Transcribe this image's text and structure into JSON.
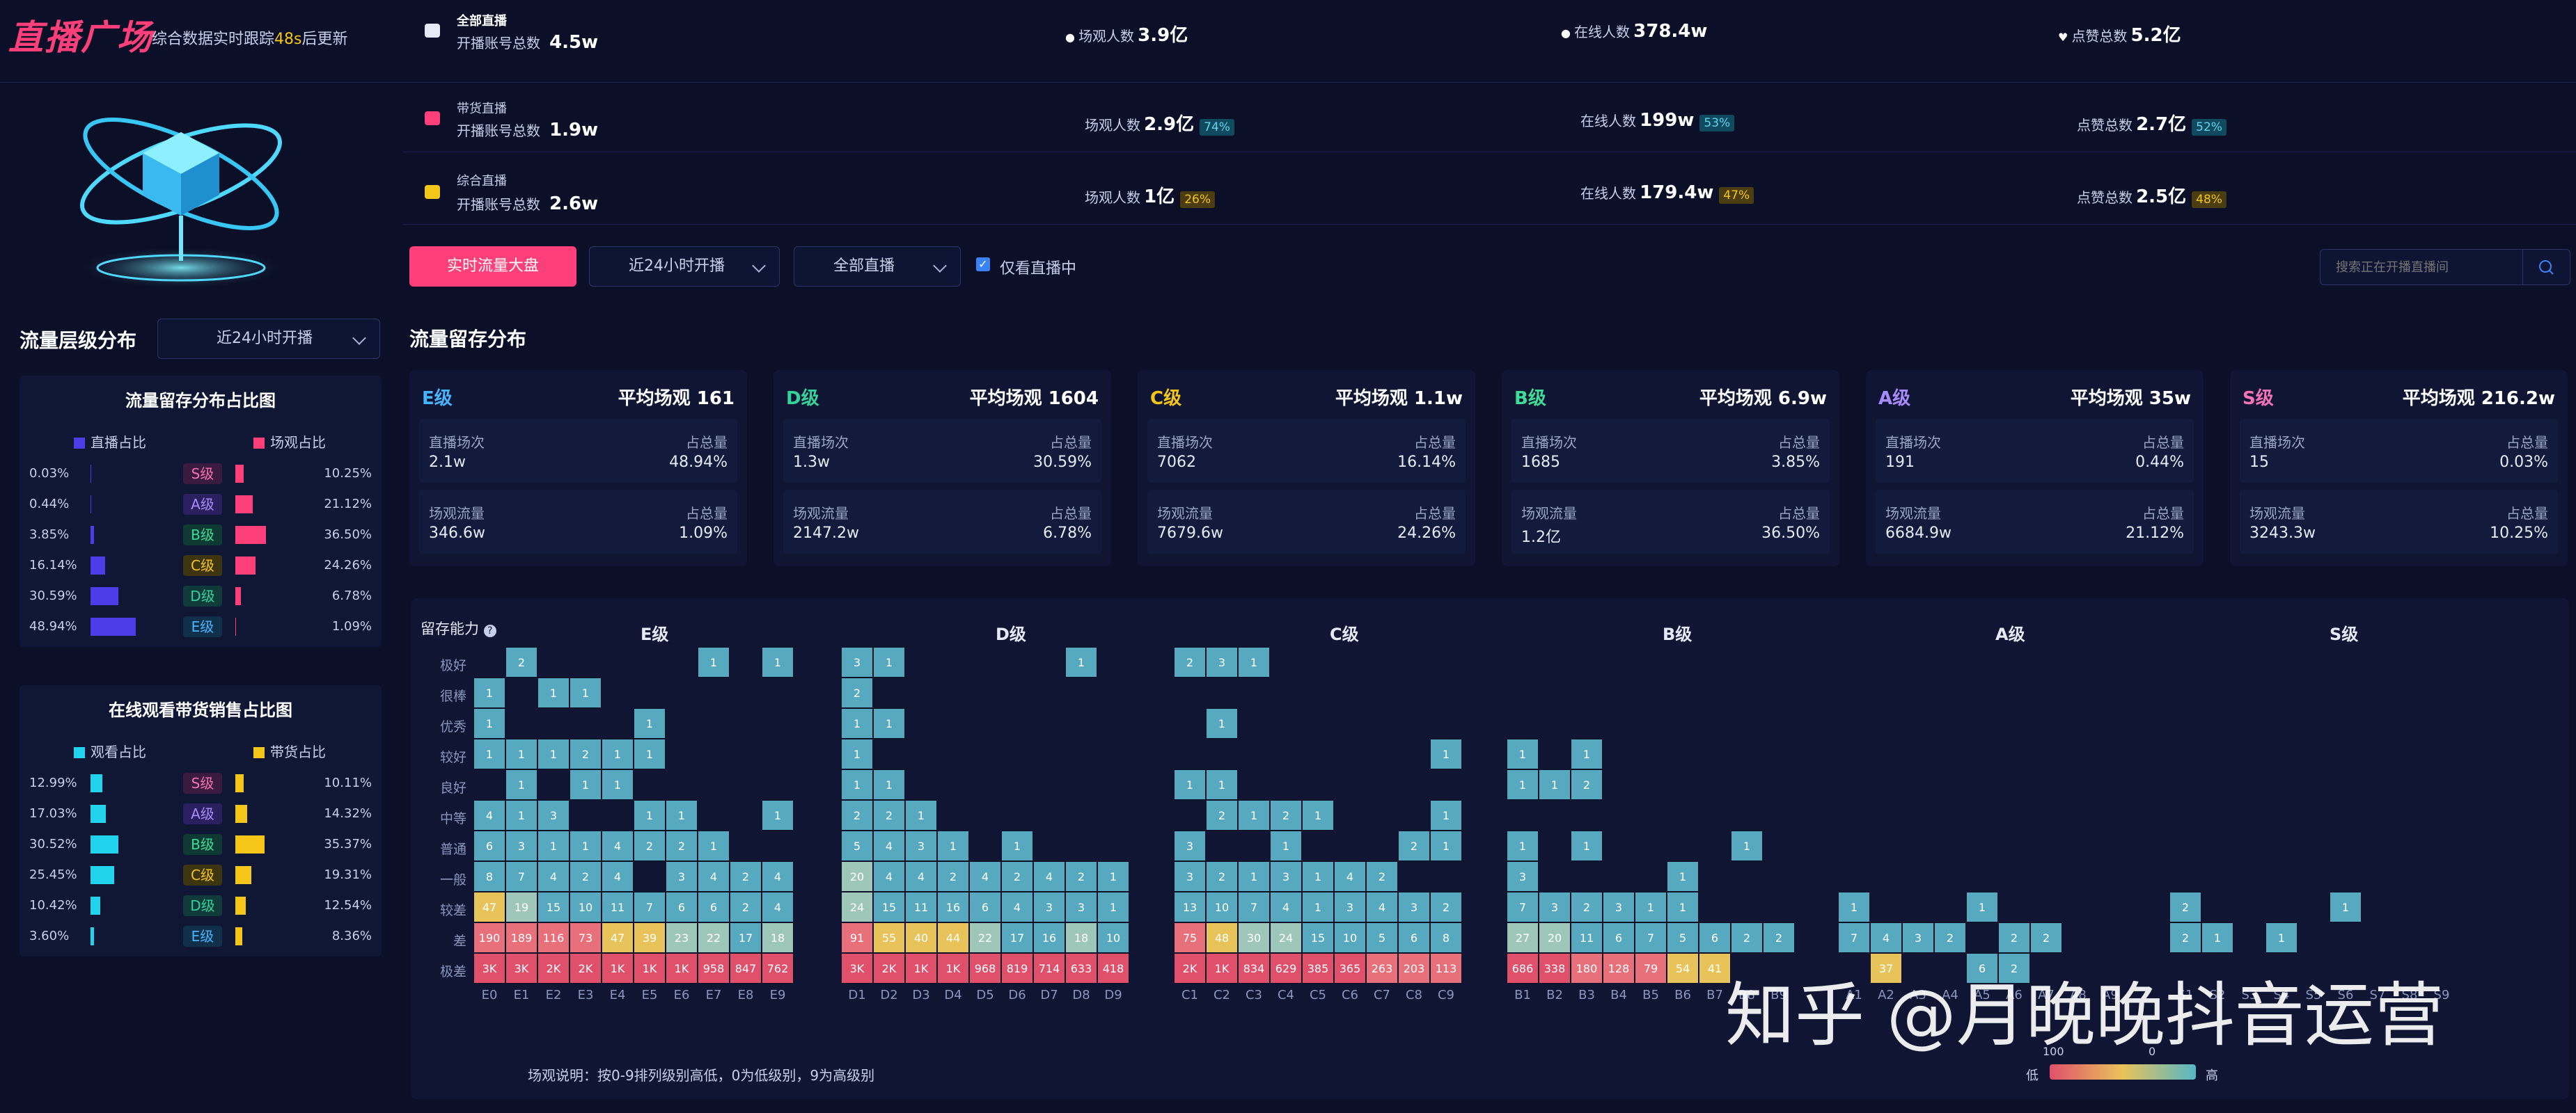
{
  "brand": {
    "title": "直播广场",
    "subtitle_prefix": "综合数据实时跟踪",
    "countdown": "48s",
    "subtitle_suffix": "后更新"
  },
  "summary_rows": [
    {
      "name": "全部直播",
      "accounts_label": "开播账号总数",
      "accounts": "4.5w",
      "viewers_label": "场观人数",
      "viewers": "3.9亿",
      "viewers_pct": "",
      "online_label": "在线人数",
      "online": "378.4w",
      "online_pct": "",
      "likes_label": "点赞总数",
      "likes": "5.2亿",
      "likes_pct": ""
    },
    {
      "name": "带货直播",
      "accounts_label": "开播账号总数",
      "accounts": "1.9w",
      "viewers_label": "场观人数",
      "viewers": "2.9亿",
      "viewers_pct": "74%",
      "online_label": "在线人数",
      "online": "199w",
      "online_pct": "53%",
      "likes_label": "点赞总数",
      "likes": "2.7亿",
      "likes_pct": "52%"
    },
    {
      "name": "综合直播",
      "accounts_label": "开播账号总数",
      "accounts": "2.6w",
      "viewers_label": "场观人数",
      "viewers": "1亿",
      "viewers_pct": "26%",
      "online_label": "在线人数",
      "online": "179.4w",
      "online_pct": "47%",
      "likes_label": "点赞总数",
      "likes": "2.5亿",
      "likes_pct": "48%"
    }
  ],
  "toolbar": {
    "primary_button": "实时流量大盘",
    "time_select": "近24小时开播",
    "type_select": "全部直播",
    "only_live_label": "仅看直播中",
    "search_placeholder": "搜索正在开播直播间"
  },
  "left": {
    "section_title": "流量层级分布",
    "time_select": "近24小时开播",
    "chart1": {
      "title": "流量留存分布占比图",
      "legend_left": "直播占比",
      "legend_right": "场观占比",
      "rows": [
        {
          "level": "S级",
          "left": "0.03%",
          "right": "10.25%",
          "left_v": 0.03,
          "right_v": 10.25
        },
        {
          "level": "A级",
          "left": "0.44%",
          "right": "21.12%",
          "left_v": 0.44,
          "right_v": 21.12
        },
        {
          "level": "B级",
          "left": "3.85%",
          "right": "36.50%",
          "left_v": 3.85,
          "right_v": 36.5
        },
        {
          "level": "C级",
          "left": "16.14%",
          "right": "24.26%",
          "left_v": 16.14,
          "right_v": 24.26
        },
        {
          "level": "D级",
          "left": "30.59%",
          "right": "6.78%",
          "left_v": 30.59,
          "right_v": 6.78
        },
        {
          "level": "E级",
          "left": "48.94%",
          "right": "1.09%",
          "left_v": 48.94,
          "right_v": 1.09
        }
      ]
    },
    "chart2": {
      "title": "在线观看带货销售占比图",
      "legend_left": "观看占比",
      "legend_right": "带货占比",
      "rows": [
        {
          "level": "S级",
          "left": "12.99%",
          "right": "10.11%",
          "left_v": 12.99,
          "right_v": 10.11
        },
        {
          "level": "A级",
          "left": "17.03%",
          "right": "14.32%",
          "left_v": 17.03,
          "right_v": 14.32
        },
        {
          "level": "B级",
          "left": "30.52%",
          "right": "35.37%",
          "left_v": 30.52,
          "right_v": 35.37
        },
        {
          "level": "C级",
          "left": "25.45%",
          "right": "19.31%",
          "left_v": 25.45,
          "right_v": 19.31
        },
        {
          "level": "D级",
          "left": "10.42%",
          "right": "12.54%",
          "left_v": 10.42,
          "right_v": 12.54
        },
        {
          "level": "E级",
          "left": "3.60%",
          "right": "8.36%",
          "left_v": 3.6,
          "right_v": 8.36
        }
      ]
    }
  },
  "main": {
    "section_title": "流量留存分布",
    "cards": [
      {
        "level": "E级",
        "color": "#47b4ff",
        "avg": "平均场观 161",
        "sessions_label": "直播场次",
        "sessions": "2.1w",
        "share_label": "占总量",
        "sessions_share": "48.94%",
        "traffic_label": "场观流量",
        "traffic": "346.6w",
        "traffic_share": "1.09%"
      },
      {
        "level": "D级",
        "color": "#34d399",
        "avg": "平均场观 1604",
        "sessions_label": "直播场次",
        "sessions": "1.3w",
        "share_label": "占总量",
        "sessions_share": "30.59%",
        "traffic_label": "场观流量",
        "traffic": "2147.2w",
        "traffic_share": "6.78%"
      },
      {
        "level": "C级",
        "color": "#f5c518",
        "avg": "平均场观 1.1w",
        "sessions_label": "直播场次",
        "sessions": "7062",
        "share_label": "占总量",
        "sessions_share": "16.14%",
        "traffic_label": "场观流量",
        "traffic": "7679.6w",
        "traffic_share": "24.26%"
      },
      {
        "level": "B级",
        "color": "#3ddc97",
        "avg": "平均场观 6.9w",
        "sessions_label": "直播场次",
        "sessions": "1685",
        "share_label": "占总量",
        "sessions_share": "3.85%",
        "traffic_label": "场观流量",
        "traffic": "1.2亿",
        "traffic_share": "36.50%"
      },
      {
        "level": "A级",
        "color": "#a78bfa",
        "avg": "平均场观 35w",
        "sessions_label": "直播场次",
        "sessions": "191",
        "share_label": "占总量",
        "sessions_share": "0.44%",
        "traffic_label": "场观流量",
        "traffic": "6684.9w",
        "traffic_share": "21.12%"
      },
      {
        "level": "S级",
        "color": "#f472b6",
        "avg": "平均场观 216.2w",
        "sessions_label": "直播场次",
        "sessions": "15",
        "share_label": "占总量",
        "sessions_share": "0.03%",
        "traffic_label": "场观流量",
        "traffic": "3243.3w",
        "traffic_share": "10.25%"
      }
    ]
  },
  "chart_data": {
    "type": "heatmap",
    "ylabel": "留存能力",
    "y_categories": [
      "极好",
      "很棒",
      "优秀",
      "较好",
      "良好",
      "中等",
      "普通",
      "一般",
      "较差",
      "差",
      "极差"
    ],
    "groups": [
      {
        "name": "E级",
        "x": [
          "E0",
          "E1",
          "E2",
          "E3",
          "E4",
          "E5",
          "E6",
          "E7",
          "E8",
          "E9"
        ],
        "rows": [
          [
            "",
            "2",
            "",
            "",
            "",
            "",
            "",
            "1",
            "",
            "1"
          ],
          [
            "1",
            "",
            "1",
            "1",
            "",
            "",
            "",
            "",
            "",
            ""
          ],
          [
            "1",
            "",
            "",
            "",
            "",
            "1",
            "",
            "",
            "",
            ""
          ],
          [
            "1",
            "1",
            "1",
            "2",
            "1",
            "1",
            "",
            "",
            "",
            ""
          ],
          [
            "",
            "1",
            "",
            "1",
            "1",
            "",
            "",
            "",
            "",
            ""
          ],
          [
            "4",
            "1",
            "3",
            "",
            "",
            "1",
            "1",
            "",
            "",
            "1"
          ],
          [
            "6",
            "3",
            "1",
            "1",
            "4",
            "2",
            "2",
            "1",
            "",
            ""
          ],
          [
            "8",
            "7",
            "4",
            "2",
            "4",
            "",
            "3",
            "4",
            "2",
            "4"
          ],
          [
            "47",
            "19",
            "15",
            "10",
            "11",
            "7",
            "6",
            "6",
            "2",
            "4"
          ],
          [
            "190",
            "189",
            "116",
            "73",
            "47",
            "39",
            "23",
            "22",
            "17",
            "18"
          ],
          [
            "3K",
            "3K",
            "2K",
            "2K",
            "1K",
            "1K",
            "1K",
            "958",
            "847",
            "762"
          ]
        ]
      },
      {
        "name": "D级",
        "x": [
          "D1",
          "D2",
          "D3",
          "D4",
          "D5",
          "D6",
          "D7",
          "D8",
          "D9"
        ],
        "rows": [
          [
            "3",
            "1",
            "",
            "",
            "",
            "",
            "",
            "1",
            ""
          ],
          [
            "2",
            "",
            "",
            "",
            "",
            "",
            "",
            "",
            ""
          ],
          [
            "1",
            "1",
            "",
            "",
            "",
            "",
            "",
            "",
            ""
          ],
          [
            "1",
            "",
            "",
            "",
            "",
            "",
            "",
            "",
            ""
          ],
          [
            "1",
            "1",
            "",
            "",
            "",
            "",
            "",
            "",
            ""
          ],
          [
            "2",
            "2",
            "1",
            "",
            "",
            "",
            "",
            "",
            ""
          ],
          [
            "5",
            "4",
            "3",
            "1",
            "",
            "1",
            "",
            "",
            ""
          ],
          [
            "20",
            "4",
            "4",
            "2",
            "4",
            "2",
            "4",
            "2",
            "1"
          ],
          [
            "24",
            "15",
            "11",
            "16",
            "6",
            "4",
            "3",
            "3",
            "1"
          ],
          [
            "91",
            "55",
            "40",
            "44",
            "22",
            "17",
            "16",
            "18",
            "10"
          ],
          [
            "3K",
            "2K",
            "1K",
            "1K",
            "968",
            "819",
            "714",
            "633",
            "418"
          ]
        ]
      },
      {
        "name": "C级",
        "x": [
          "C1",
          "C2",
          "C3",
          "C4",
          "C5",
          "C6",
          "C7",
          "C8",
          "C9"
        ],
        "rows": [
          [
            "2",
            "3",
            "1",
            "",
            "",
            "",
            "",
            "",
            ""
          ],
          [
            "",
            "",
            "",
            "",
            "",
            "",
            "",
            "",
            ""
          ],
          [
            "",
            "1",
            "",
            "",
            "",
            "",
            "",
            "",
            ""
          ],
          [
            "",
            "",
            "",
            "",
            "",
            "",
            "",
            "",
            "1"
          ],
          [
            "1",
            "1",
            "",
            "",
            "",
            "",
            "",
            "",
            ""
          ],
          [
            "",
            "2",
            "1",
            "2",
            "1",
            "",
            "",
            "",
            "1"
          ],
          [
            "3",
            "",
            "",
            "1",
            "",
            "",
            "",
            "2",
            "1"
          ],
          [
            "3",
            "2",
            "1",
            "3",
            "1",
            "4",
            "2",
            "",
            ""
          ],
          [
            "13",
            "10",
            "7",
            "4",
            "1",
            "3",
            "4",
            "3",
            "2"
          ],
          [
            "75",
            "48",
            "30",
            "24",
            "15",
            "10",
            "5",
            "6",
            "8"
          ],
          [
            "2K",
            "1K",
            "834",
            "629",
            "385",
            "365",
            "263",
            "203",
            "113"
          ]
        ]
      },
      {
        "name": "B级",
        "x": [
          "B1",
          "B2",
          "B3",
          "B4",
          "B5",
          "B6",
          "B7",
          "B8",
          "B9"
        ],
        "rows": [
          [
            "",
            "",
            "",
            "",
            "",
            "",
            "",
            "",
            ""
          ],
          [
            "",
            "",
            "",
            "",
            "",
            "",
            "",
            "",
            ""
          ],
          [
            "",
            "",
            "",
            "",
            "",
            "",
            "",
            "",
            ""
          ],
          [
            "1",
            "",
            "1",
            "",
            "",
            "",
            "",
            "",
            ""
          ],
          [
            "1",
            "1",
            "2",
            "",
            "",
            "",
            "",
            "",
            ""
          ],
          [
            "",
            "",
            "",
            "",
            "",
            "",
            "",
            "",
            ""
          ],
          [
            "1",
            "",
            "1",
            "",
            "",
            "",
            "",
            "1",
            ""
          ],
          [
            "3",
            "",
            "",
            "",
            "",
            "1",
            "",
            "",
            ""
          ],
          [
            "7",
            "3",
            "2",
            "3",
            "1",
            "1",
            "",
            "",
            ""
          ],
          [
            "27",
            "20",
            "11",
            "6",
            "7",
            "5",
            "6",
            "2",
            "2"
          ],
          [
            "686",
            "338",
            "180",
            "128",
            "79",
            "54",
            "41",
            "",
            ""
          ]
        ]
      },
      {
        "name": "A级",
        "x": [
          "A1",
          "A2",
          "A3",
          "A4",
          "A5",
          "A6",
          "A7",
          "A8",
          "A9"
        ],
        "rows": [
          [
            "",
            "",
            "",
            "",
            "",
            "",
            "",
            "",
            ""
          ],
          [
            "",
            "",
            "",
            "",
            "",
            "",
            "",
            "",
            ""
          ],
          [
            "",
            "",
            "",
            "",
            "",
            "",
            "",
            "",
            ""
          ],
          [
            "",
            "",
            "",
            "",
            "",
            "",
            "",
            "",
            ""
          ],
          [
            "",
            "",
            "",
            "",
            "",
            "",
            "",
            "",
            ""
          ],
          [
            "",
            "",
            "",
            "",
            "",
            "",
            "",
            "",
            ""
          ],
          [
            "",
            "",
            "",
            "",
            "",
            "",
            "",
            "",
            ""
          ],
          [
            "",
            "",
            "",
            "",
            "",
            "",
            "",
            "",
            ""
          ],
          [
            "1",
            "",
            "",
            "",
            "1",
            "",
            "",
            "",
            ""
          ],
          [
            "7",
            "4",
            "3",
            "2",
            "",
            "2",
            "2",
            "",
            ""
          ],
          [
            "",
            "37",
            "",
            "",
            "6",
            "2",
            "",
            "",
            ""
          ]
        ]
      },
      {
        "name": "S级",
        "x": [
          "S1",
          "S2",
          "S3",
          "S4",
          "S5",
          "S6",
          "S7",
          "S8",
          "S9"
        ],
        "rows": [
          [
            "",
            "",
            "",
            "",
            "",
            "",
            "",
            "",
            ""
          ],
          [
            "",
            "",
            "",
            "",
            "",
            "",
            "",
            "",
            ""
          ],
          [
            "",
            "",
            "",
            "",
            "",
            "",
            "",
            "",
            ""
          ],
          [
            "",
            "",
            "",
            "",
            "",
            "",
            "",
            "",
            ""
          ],
          [
            "",
            "",
            "",
            "",
            "",
            "",
            "",
            "",
            ""
          ],
          [
            "",
            "",
            "",
            "",
            "",
            "",
            "",
            "",
            ""
          ],
          [
            "",
            "",
            "",
            "",
            "",
            "",
            "",
            "",
            ""
          ],
          [
            "",
            "",
            "",
            "",
            "",
            "",
            "",
            "",
            ""
          ],
          [
            "2",
            "",
            "",
            "",
            "",
            "1",
            "",
            "",
            ""
          ],
          [
            "2",
            "1",
            "",
            "1",
            "",
            "",
            "",
            "",
            ""
          ],
          [
            "",
            "",
            "",
            "",
            "",
            "",
            "",
            "",
            ""
          ]
        ]
      }
    ],
    "note": "场观说明：按0-9排列级别高低，0为低级别，9为高级别",
    "legend": {
      "low_label": "低",
      "high_label": "高",
      "left_value": "100",
      "right_value": "0"
    }
  },
  "watermark": "知乎 @月晚晚抖音运营"
}
